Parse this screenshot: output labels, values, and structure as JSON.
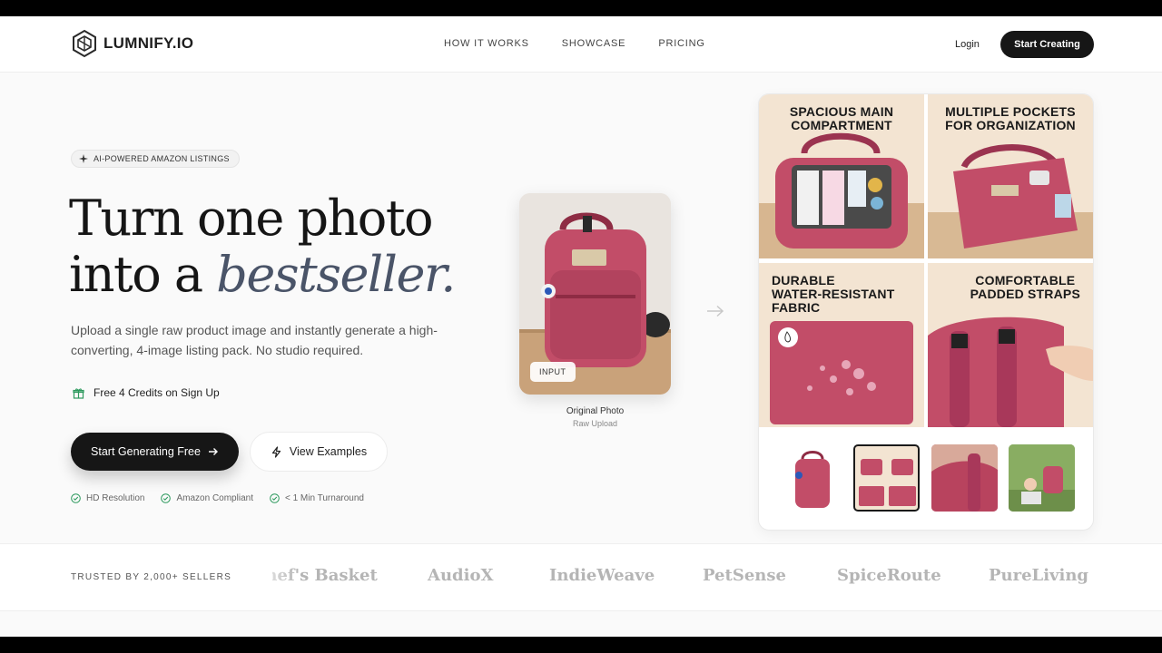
{
  "nav": {
    "logo_text": "LUMNIFY.IO",
    "links": [
      "HOW IT WORKS",
      "SHOWCASE",
      "PRICING"
    ],
    "login": "Login",
    "cta": "Start Creating"
  },
  "hero": {
    "badge": "AI-POWERED AMAZON LISTINGS",
    "headline_line1": "Turn one photo",
    "headline_line2_prefix": "into a",
    "headline_accent": "bestseller.",
    "subtext": "Upload a single raw product image and instantly generate a high-converting, 4-image listing pack. No studio required.",
    "credits": "Free 4 Credits on Sign Up",
    "primary_button": "Start Generating Free",
    "secondary_button": "View Examples",
    "features": [
      "HD Resolution",
      "Amazon Compliant",
      "< 1 Min Turnaround"
    ]
  },
  "input_photo": {
    "tag": "INPUT",
    "label": "Original Photo",
    "sublabel": "Raw Upload"
  },
  "result": {
    "tiles": [
      {
        "title_line1": "SPACIOUS MAIN",
        "title_line2": "COMPARTMENT"
      },
      {
        "title_line1": "MULTIPLE POCKETS",
        "title_line2": "FOR ORGANIZATION"
      },
      {
        "title_line1": "DURABLE",
        "title_line2": "WATER-RESISTANT",
        "title_line3": "FABRIC"
      },
      {
        "title_line1": "COMFORTABLE",
        "title_line2": "PADDED STRAPS"
      }
    ]
  },
  "trusted": {
    "label": "TRUSTED BY 2,000+ SELLERS",
    "brands": [
      "Chef's Basket",
      "AudioX",
      "IndieWeave",
      "PetSense",
      "SpiceRoute",
      "PureLiving"
    ]
  },
  "colors": {
    "dark": "#161616",
    "accent": "#4a5468",
    "check_green": "#2e9a5e",
    "bag_pink": "#c24d68",
    "tile_bg": "#f3e4d2"
  }
}
